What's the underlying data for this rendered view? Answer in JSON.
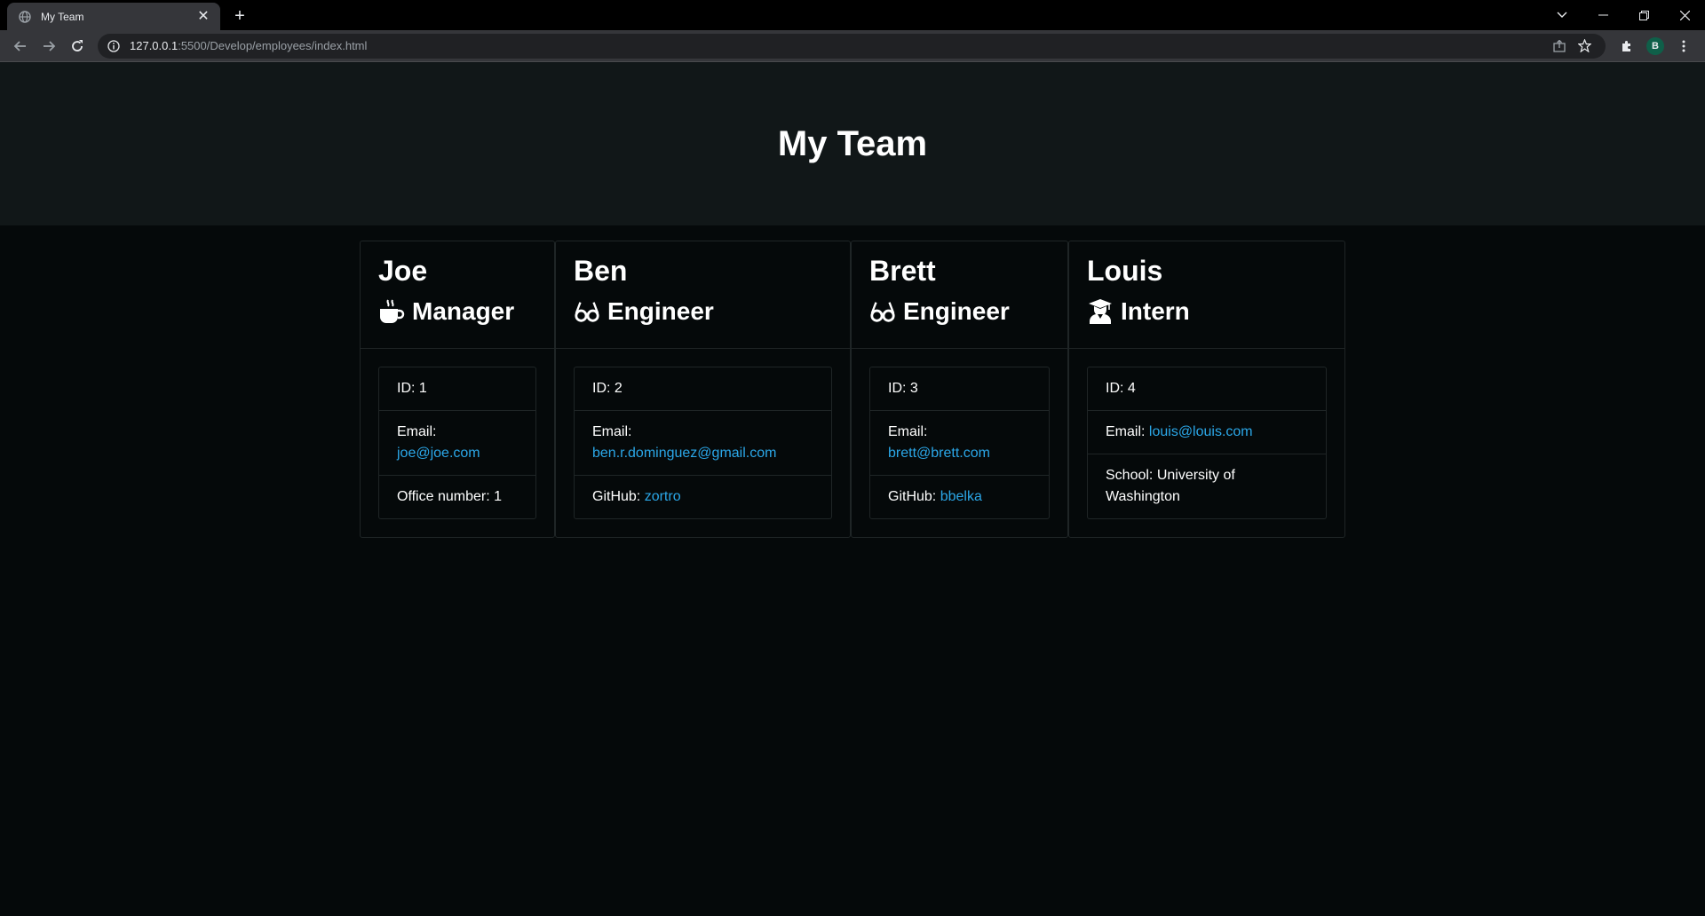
{
  "browser": {
    "tab_title": "My Team",
    "url_host": "127.0.0.1",
    "url_rest": ":5500/Develop/employees/index.html",
    "profile_initial": "B"
  },
  "page": {
    "title": "My Team"
  },
  "employees": [
    {
      "name": "Joe",
      "role": "Manager",
      "role_icon": "coffee-icon",
      "id_text": "ID: 1",
      "email_label": "Email:",
      "email": "joe@joe.com",
      "extra_label": "Office number: 1",
      "extra_link": ""
    },
    {
      "name": "Ben",
      "role": "Engineer",
      "role_icon": "glasses-icon",
      "id_text": "ID: 2",
      "email_label": "Email:",
      "email": "ben.r.dominguez@gmail.com",
      "extra_label": "GitHub:",
      "extra_link": "zortro"
    },
    {
      "name": "Brett",
      "role": "Engineer",
      "role_icon": "glasses-icon",
      "id_text": "ID: 3",
      "email_label": "Email:",
      "email": "brett@brett.com",
      "extra_label": "GitHub:",
      "extra_link": "bbelka"
    },
    {
      "name": "Louis",
      "role": "Intern",
      "role_icon": "graduate-icon",
      "id_text": "ID: 4",
      "email_label": "Email:",
      "email": "louis@louis.com",
      "extra_label": "School: University of Washington",
      "extra_link": ""
    }
  ]
}
